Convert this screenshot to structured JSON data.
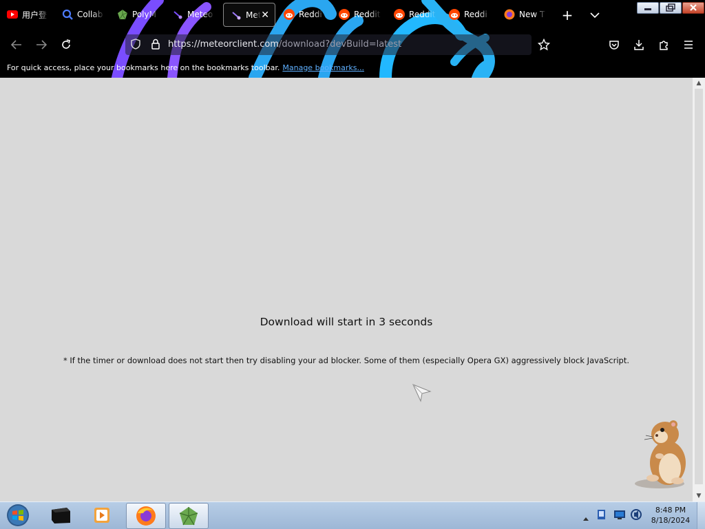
{
  "browser": {
    "tabs": [
      {
        "label": "用户登",
        "icon": "youtube-icon",
        "active": false
      },
      {
        "label": "Collab",
        "icon": "search-icon",
        "active": false
      },
      {
        "label": "PolyM",
        "icon": "polymc-icon",
        "active": false
      },
      {
        "label": "Meteo",
        "icon": "meteor-icon",
        "active": false
      },
      {
        "label": "Met",
        "icon": "meteor-icon",
        "active": true
      },
      {
        "label": "Reddi",
        "icon": "reddit-icon",
        "active": false
      },
      {
        "label": "Reddit",
        "icon": "reddit-icon",
        "active": false
      },
      {
        "label": "Reddit",
        "icon": "reddit-icon",
        "active": false
      },
      {
        "label": "Reddi",
        "icon": "reddit-icon",
        "active": false
      },
      {
        "label": "New T",
        "icon": "firefox-icon",
        "active": false
      }
    ],
    "url": {
      "domain": "https://meteorclient.com",
      "path": "/download?devBuild=latest"
    },
    "bookmarks_bar": {
      "text": "For quick access, place your bookmarks here on the bookmarks toolbar.",
      "link": "Manage bookmarks..."
    }
  },
  "content": {
    "message": "Download will start in 3 seconds",
    "note": "* If the timer or download does not start then try disabling your ad blocker. Some of them (especially Opera GX) aggressively block JavaScript."
  },
  "taskbar": {
    "time": "8:48 PM",
    "date": "8/18/2024"
  },
  "colors": {
    "theme_cyan": "#29b3f5",
    "theme_purple": "#7a4dff",
    "content_bg": "#d9d9d9",
    "link": "#5fb0ff"
  }
}
